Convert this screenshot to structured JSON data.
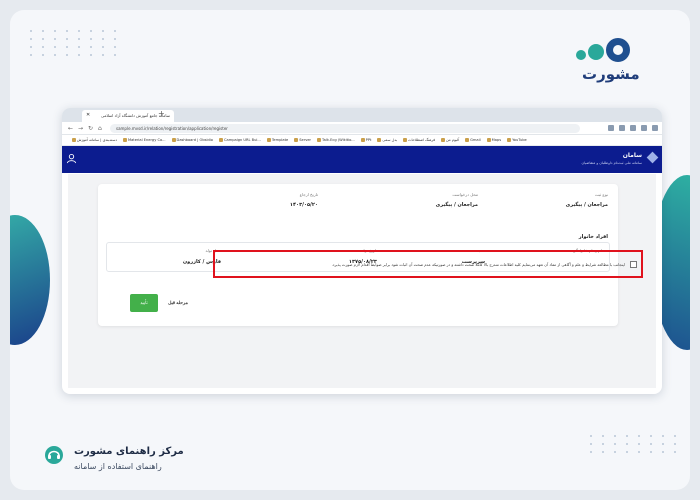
{
  "brand": {
    "name": "مشورت",
    "accent": "#2aa89a",
    "dark": "#1f4f8f"
  },
  "browser": {
    "tab_title": "سامانه جامع آموزش دانشگاه آزاد اسلامی",
    "url": "sample.mvsd.ir/relation/registration/application/register",
    "bookmarks": [
      "دسته‌بندی | سامانه آموزش",
      "Material Energy Co...",
      "Dashboard | Obsidio",
      "Campaign URL Bui...",
      "Template",
      "Server",
      "Talk.Ecg (Wikitio...",
      "PPt",
      "بدل سمی",
      "فرهنگ اصطلاحات",
      "آلبوم من",
      "Gmail",
      "Maps",
      "YouTube"
    ]
  },
  "app": {
    "title": "سامان",
    "subtitle": "سامانه ملی ثبت‌نام داوطلبان و متقاضیان",
    "header_color": "#0c1c8f"
  },
  "form": {
    "reg_type_label": "نوع ثبت",
    "reg_type_value": "مراجعان / پیگیری",
    "request_label": "محل درخواست",
    "request_value": "مراجعان / پیگیری",
    "ref_date_label": "تاریخ ارجاع",
    "ref_date_value": "۱۴۰۳/۰۵/۲۰",
    "section_title": "افراد خانوار",
    "name_label": "نام و نام خانوادگی",
    "name_value": "",
    "relation_label": "نسبت",
    "relation_value": "سرپرست",
    "birth_label": "تاریخ تولد",
    "birth_value": "۱۳۷۵/۰۸/۲۳",
    "birthplace_label": "محل تولد",
    "birthplace_value": "فارس / کازرون",
    "terms_text": "اینجانب با مطالعه شرایط و علم و آگاهی از مفاد آن تعهد می‌نمایم کلیه اطلاعات مندرج بالا کاملا صحت داشته و در صورتیکه عدم صحت آن اثبات شود برابر ضوابط اقدام لازم صورت پذیرد.",
    "confirm_label": "تأیید",
    "prev_label": "مرحله قبل",
    "highlight_color": "#e0121d"
  },
  "footer": {
    "title": "مرکز راهنمای مشورت",
    "subtitle": "راهنمای استفاده از سامانه"
  }
}
